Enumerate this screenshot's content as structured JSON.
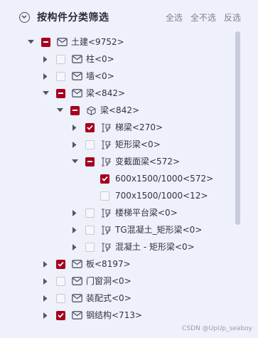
{
  "header": {
    "title": "按构件分类筛选",
    "actions": [
      "全选",
      "全不选",
      "反选"
    ]
  },
  "tree": [
    {
      "label": "土建<9752>",
      "state": "partial",
      "icon": "envelope-icon",
      "level": 0,
      "arrow": "down"
    },
    {
      "label": "柱<0>",
      "state": "unchecked",
      "icon": "envelope-icon",
      "level": 1,
      "arrow": "right"
    },
    {
      "label": "墙<0>",
      "state": "unchecked",
      "icon": "envelope-icon",
      "level": 1,
      "arrow": "right"
    },
    {
      "label": "梁<842>",
      "state": "partial",
      "icon": "envelope-icon",
      "level": 1,
      "arrow": "down"
    },
    {
      "label": "梁<842>",
      "state": "partial",
      "icon": "cube-icon",
      "level": 2,
      "arrow": "down"
    },
    {
      "label": "梯梁<270>",
      "state": "checked",
      "icon": "beam-icon",
      "level": 3,
      "arrow": "right"
    },
    {
      "label": "矩形梁<0>",
      "state": "unchecked",
      "icon": "beam-icon",
      "level": 3,
      "arrow": "right"
    },
    {
      "label": "变截面梁<572>",
      "state": "partial",
      "icon": "beam-icon",
      "level": 3,
      "arrow": "down"
    },
    {
      "label": "600x1500/1000<572>",
      "state": "checked",
      "icon": "",
      "level": 4,
      "arrow": "none"
    },
    {
      "label": "700x1500/1000<12>",
      "state": "unchecked",
      "icon": "",
      "level": 4,
      "arrow": "none"
    },
    {
      "label": "楼梯平台梁<0>",
      "state": "unchecked",
      "icon": "beam-icon",
      "level": 3,
      "arrow": "right"
    },
    {
      "label": "TG混凝土_矩形梁<0>",
      "state": "unchecked",
      "icon": "beam-icon",
      "level": 3,
      "arrow": "right"
    },
    {
      "label": "混凝土 - 矩形梁<0>",
      "state": "unchecked",
      "icon": "beam-icon",
      "level": 3,
      "arrow": "right"
    },
    {
      "label": "板<8197>",
      "state": "checked",
      "icon": "envelope-icon",
      "level": 1,
      "arrow": "right"
    },
    {
      "label": "门窗洞<0>",
      "state": "unchecked",
      "icon": "envelope-icon",
      "level": 1,
      "arrow": "right"
    },
    {
      "label": "装配式<0>",
      "state": "unchecked",
      "icon": "envelope-icon",
      "level": 1,
      "arrow": "right"
    },
    {
      "label": "钢结构<713>",
      "state": "checked",
      "icon": "envelope-icon",
      "level": 1,
      "arrow": "right"
    }
  ],
  "watermark": "CSDN @UpUp_seaboy",
  "colors": {
    "accent": "#a4001f",
    "background": "#eef0fa"
  }
}
